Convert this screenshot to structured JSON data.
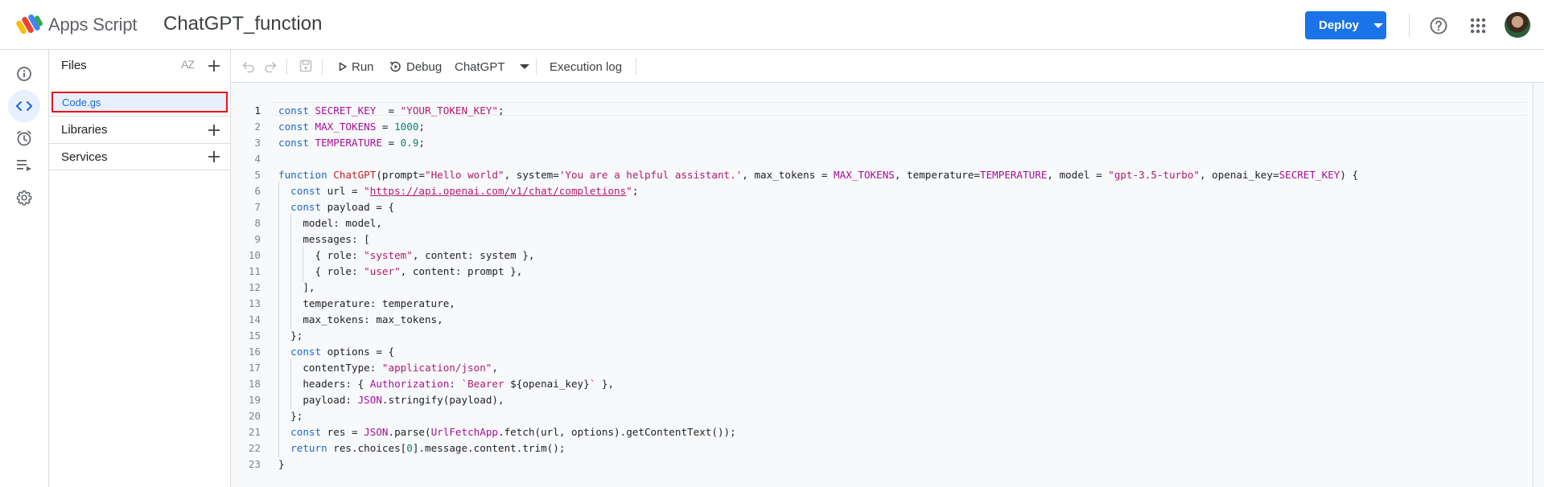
{
  "header": {
    "app_name": "Apps Script",
    "project_title": "ChatGPT_function",
    "deploy_label": "Deploy"
  },
  "rail": {
    "items": [
      {
        "icon": "info-icon",
        "label": "Overview"
      },
      {
        "icon": "code-icon",
        "label": "Editor",
        "active": true
      },
      {
        "icon": "alarm-clock-icon",
        "label": "Triggers"
      },
      {
        "icon": "list-run-icon",
        "label": "Executions"
      },
      {
        "icon": "gear-icon",
        "label": "Project Settings"
      }
    ]
  },
  "files_panel": {
    "files_label": "Files",
    "sort_label": "AZ",
    "files": [
      "Code.gs"
    ],
    "libraries_label": "Libraries",
    "services_label": "Services"
  },
  "toolbar": {
    "run_label": "Run",
    "debug_label": "Debug",
    "function_select": "ChatGPT",
    "execution_log_label": "Execution log"
  },
  "editor": {
    "active_line": 1,
    "lines": [
      [
        [
          "kw",
          "const "
        ],
        [
          "cn",
          "SECRET_KEY"
        ],
        [
          "",
          "  = "
        ],
        [
          "str",
          "\"YOUR_TOKEN_KEY\""
        ],
        [
          "",
          ";"
        ]
      ],
      [
        [
          "kw",
          "const "
        ],
        [
          "cn",
          "MAX_TOKENS"
        ],
        [
          "",
          " = "
        ],
        [
          "num",
          "1000"
        ],
        [
          "",
          ";"
        ]
      ],
      [
        [
          "kw",
          "const "
        ],
        [
          "cn",
          "TEMPERATURE"
        ],
        [
          "",
          " = "
        ],
        [
          "num",
          "0.9"
        ],
        [
          "",
          ";"
        ]
      ],
      [],
      [
        [
          "kw",
          "function "
        ],
        [
          "fn",
          "ChatGPT"
        ],
        [
          "",
          "(prompt="
        ],
        [
          "str",
          "\"Hello world\""
        ],
        [
          "",
          ", system="
        ],
        [
          "str",
          "'You are a helpful assistant.'"
        ],
        [
          "",
          ", max_tokens = "
        ],
        [
          "cn",
          "MAX_TOKENS"
        ],
        [
          "",
          ", temperature="
        ],
        [
          "cn",
          "TEMPERATURE"
        ],
        [
          "",
          ", model = "
        ],
        [
          "str",
          "\"gpt-3.5-turbo\""
        ],
        [
          "",
          ", openai_key="
        ],
        [
          "cn",
          "SECRET_KEY"
        ],
        [
          "",
          ") {"
        ]
      ],
      [
        [
          "",
          "  "
        ],
        [
          "kw",
          "const "
        ],
        [
          "",
          "url = "
        ],
        [
          "str",
          "\""
        ],
        [
          "url",
          "https://api.openai.com/v1/chat/completions"
        ],
        [
          "str",
          "\""
        ],
        [
          "",
          ";"
        ]
      ],
      [
        [
          "",
          "  "
        ],
        [
          "kw",
          "const "
        ],
        [
          "",
          "payload = {"
        ]
      ],
      [
        [
          "",
          "    model: model,"
        ]
      ],
      [
        [
          "",
          "    messages: ["
        ]
      ],
      [
        [
          "",
          "      { role: "
        ],
        [
          "str",
          "\"system\""
        ],
        [
          "",
          ", content: system },"
        ]
      ],
      [
        [
          "",
          "      { role: "
        ],
        [
          "str",
          "\"user\""
        ],
        [
          "",
          ", content: prompt },"
        ]
      ],
      [
        [
          "",
          "    ],"
        ]
      ],
      [
        [
          "",
          "    temperature: temperature,"
        ]
      ],
      [
        [
          "",
          "    max_tokens: max_tokens,"
        ]
      ],
      [
        [
          "",
          "  };"
        ]
      ],
      [
        [
          "",
          "  "
        ],
        [
          "kw",
          "const "
        ],
        [
          "",
          "options = {"
        ]
      ],
      [
        [
          "",
          "    contentType: "
        ],
        [
          "str",
          "\"application/json\""
        ],
        [
          "",
          ","
        ]
      ],
      [
        [
          "",
          "    headers: { "
        ],
        [
          "cn",
          "Authorization"
        ],
        [
          "",
          ": "
        ],
        [
          "str",
          "`Bearer "
        ],
        [
          "",
          "${openai_key}"
        ],
        [
          "str",
          "`"
        ],
        [
          "",
          " },"
        ]
      ],
      [
        [
          "",
          "    payload: "
        ],
        [
          "cn",
          "JSON"
        ],
        [
          "",
          ".stringify(payload),"
        ]
      ],
      [
        [
          "",
          "  };"
        ]
      ],
      [
        [
          "",
          "  "
        ],
        [
          "kw",
          "const "
        ],
        [
          "",
          "res = "
        ],
        [
          "cn",
          "JSON"
        ],
        [
          "",
          ".parse("
        ],
        [
          "cn",
          "UrlFetchApp"
        ],
        [
          "",
          ".fetch(url, options).getContentText());"
        ]
      ],
      [
        [
          "",
          "  "
        ],
        [
          "kw",
          "return "
        ],
        [
          "",
          "res.choices["
        ],
        [
          "num",
          "0"
        ],
        [
          "",
          "].message.content.trim();"
        ]
      ],
      [
        [
          "",
          "}"
        ]
      ]
    ]
  }
}
